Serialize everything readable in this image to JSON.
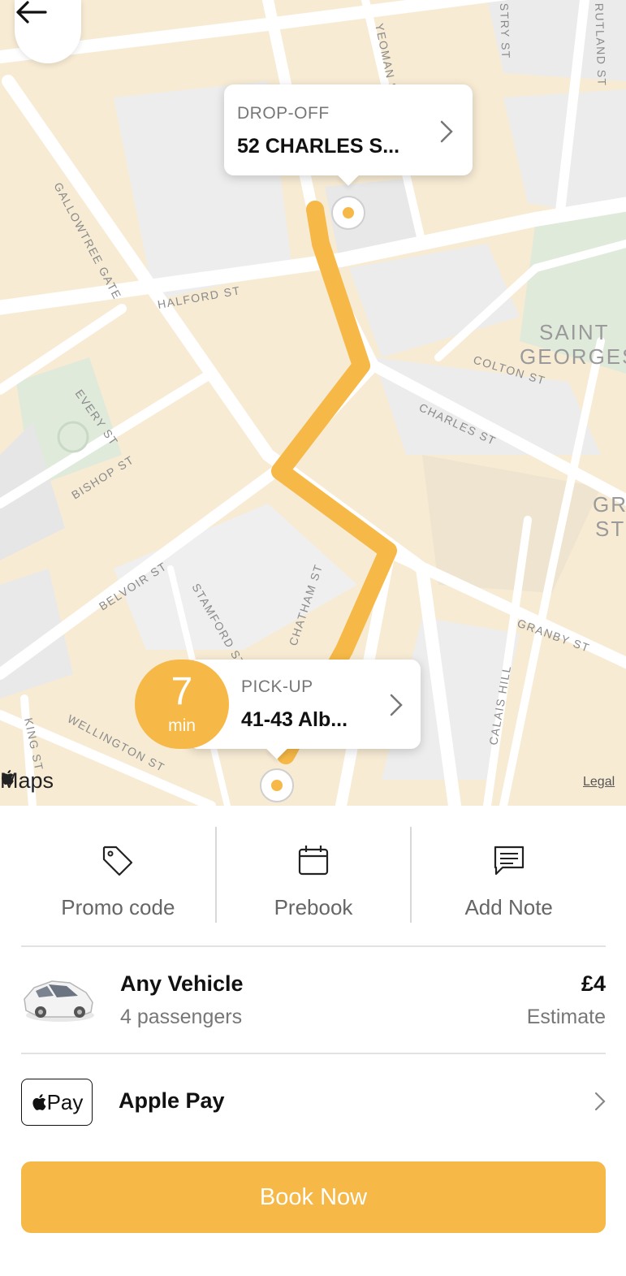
{
  "map": {
    "streets": [
      "HALFORD ST",
      "GALLOWTREE GATE",
      "EVERY ST",
      "BISHOP ST",
      "BELVOIR ST",
      "STAMFORD ST",
      "CHATHAM ST",
      "CHARLES ST",
      "COLTON ST",
      "GRANBY ST",
      "CALAIS HILL",
      "KING ST",
      "WELLINGTON ST",
      "YEOMAN ST",
      "RUTLAND ST",
      "STRY ST"
    ],
    "area_label": [
      "SAINT",
      "GEORGES"
    ],
    "area_label_2": [
      "GR",
      "ST"
    ],
    "attribution": "Maps",
    "legal": "Legal",
    "route_color": "#f6b846"
  },
  "dropoff": {
    "label": "DROP-OFF",
    "address": "52 CHARLES S..."
  },
  "pickup": {
    "label": "PICK-UP",
    "address": "41-43 Alb...",
    "eta_value": "7",
    "eta_unit": "min"
  },
  "actions": [
    {
      "label": "Promo code",
      "icon": "tag-icon"
    },
    {
      "label": "Prebook",
      "icon": "calendar-icon"
    },
    {
      "label": "Add Note",
      "icon": "note-icon"
    }
  ],
  "vehicle": {
    "name": "Any Vehicle",
    "passengers": "4 passengers",
    "price": "£4",
    "price_note": "Estimate"
  },
  "payment": {
    "badge": "Pay",
    "name": "Apple Pay"
  },
  "book_button": "Book Now",
  "colors": {
    "accent": "#f6b846"
  }
}
